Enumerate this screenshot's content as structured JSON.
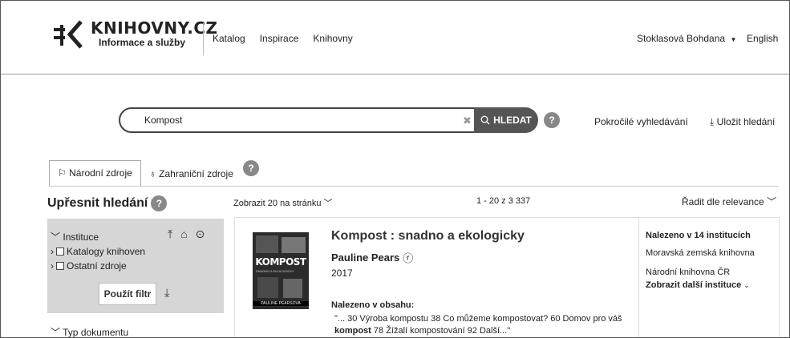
{
  "header": {
    "logo_title": "KNIHOVNY.CZ",
    "logo_subtitle": "Informace a služby",
    "nav": [
      "Katalog",
      "Inspirace",
      "Knihovny"
    ],
    "user": "Stoklasová Bohdana",
    "language": "English"
  },
  "search": {
    "value": "Kompost",
    "button_label": "HLEDAT",
    "advanced": "Pokročilé vyhledávání",
    "save": "Uložit hledání"
  },
  "tabs": [
    {
      "label": "Národní zdroje",
      "active": true
    },
    {
      "label": "Zahraniční zdroje",
      "active": false
    }
  ],
  "sidebar": {
    "title": "Upřesnit hledání",
    "filter_title": "Instituce",
    "options": [
      "Katalogy knihoven",
      "Ostatní zdroje"
    ],
    "apply_label": "Použít filtr",
    "next_section": "Typ dokumentu"
  },
  "results_bar": {
    "per_page": "Zobrazit 20 na stránku",
    "range": "1 - 20 z 3 337",
    "sort": "Řadit dle relevance"
  },
  "result": {
    "cover": {
      "title": "KOMPOST",
      "subtitle": "SNADNO A EKOLOGICKY",
      "author": "PAULINE PEARSOVA"
    },
    "title": "Kompost : snadno a ekologicky",
    "author": "Pauline Pears",
    "year": "2017",
    "found_in_content_label": "Nalezeno v obsahu:",
    "snippet_line1": "\"... 30 Výroba kompostu 38 Co můžeme kompostovat? 60 Domov pro váš",
    "snippet_bold": "kompost",
    "snippet_line2_rest": " 78 Žížalí kompostování 92 Další...\"",
    "institutions_head": "Nalezeno v 14 institucích",
    "institutions": [
      "Moravská zemská knihovna",
      "Národní knihovna ČR"
    ],
    "institutions_more": "Zobrazit další instituce"
  }
}
